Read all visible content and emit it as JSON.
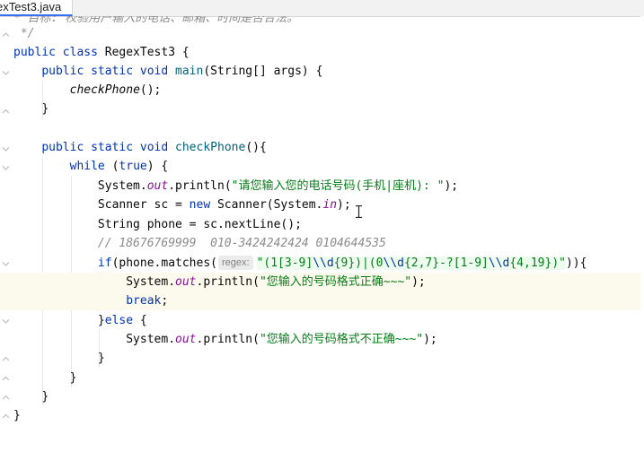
{
  "editor": {
    "tab_title": "exTest3.java",
    "colors": {
      "keyword": "#0033b3",
      "method": "#00627a",
      "string": "#067d17",
      "field": "#871094",
      "comment": "#8c8c8c",
      "caret_row": "#fcfaed",
      "regex_background": "#edfcee"
    },
    "hint_label": "regex:",
    "lines": {
      "l0": "* 目标: 校验用户输入的电话、邮箱、时间是否合法。",
      "l1": " */",
      "l2": {
        "a": "public class",
        "b": " RegexTest3 {"
      },
      "l3": {
        "a": "public static void",
        "b": "main",
        "c": "(String[] args) {"
      },
      "l4": {
        "a": "checkPhone",
        "b": "();"
      },
      "l5": "}",
      "l7": {
        "a": "public static void",
        "b": "checkPhone",
        "c": "(){"
      },
      "l8": {
        "a": "while",
        "b": " (",
        "c": "true",
        "d": ") {"
      },
      "l9": {
        "a": "System.",
        "b": "out",
        "c": ".println(",
        "d": "\"请您输入您的电话号码(手机|座机): \"",
        "e": ");"
      },
      "l10": {
        "a": "Scanner sc = ",
        "b": "new",
        "c": " Scanner(System.",
        "d": "in",
        "e": ");"
      },
      "l11": "String phone = sc.nextLine();",
      "l12": "// 18676769999  010-3424242424 0104644535",
      "l13": {
        "a": "if",
        "b": "(phone.matches(",
        "q1": "\"",
        "r1": "(1[3-9]",
        "e1": "\\\\d",
        "r2": "{9})|(0",
        "e2": "\\\\d",
        "r3": "{2,7}-?[1-9]",
        "e3": "\\\\d",
        "r4": "{4,19})",
        "q2": "\"",
        "c": ")){"
      },
      "l14": {
        "a": "System.",
        "b": "out",
        "c": ".println(",
        "d": "\"您输入的号码格式正确~~~\"",
        "e": ");"
      },
      "l15": {
        "a": "break",
        "b": ";"
      },
      "l16": {
        "a": "}",
        "b": "else",
        "c": " {"
      },
      "l17": {
        "a": "System.",
        "b": "out",
        "c": ".println(",
        "d": "\"您输入的号码格式不正确~~~\"",
        "e": ");"
      },
      "l18": "}",
      "l19": "}",
      "l20": "}",
      "l21": "}"
    }
  }
}
